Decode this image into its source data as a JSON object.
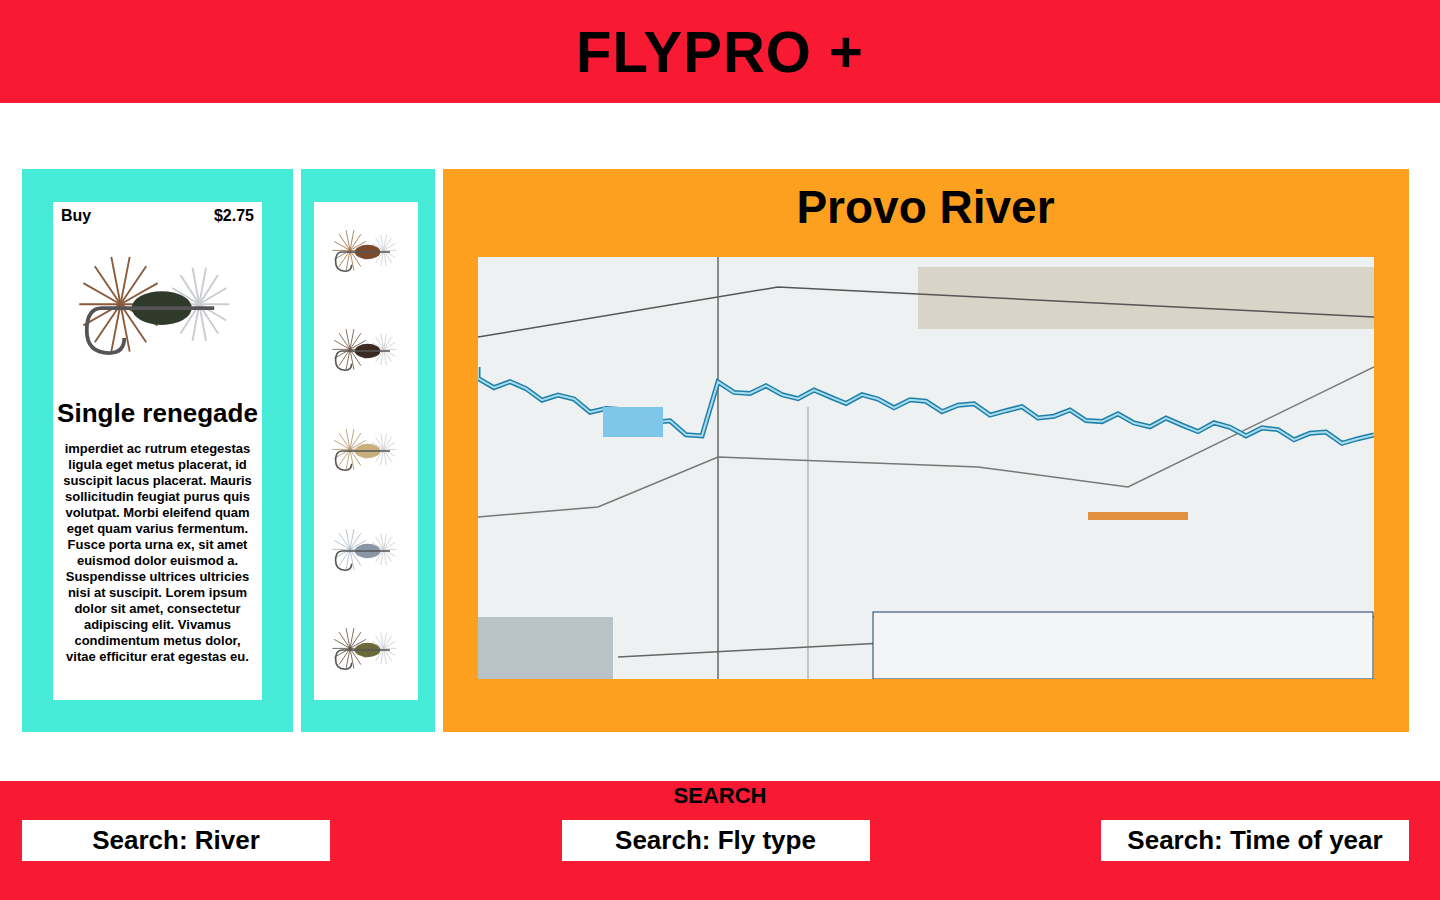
{
  "app": {
    "title": "FLYPRO +"
  },
  "product": {
    "action": "Buy",
    "price": "$2.75",
    "name": "Single renegade",
    "description": "imperdiet ac rutrum etegestas ligula eget metus placerat, id suscipit lacus placerat. Mauris sollicitudin feugiat purus quis volutpat. Morbi eleifend quam eget quam varius fermentum. Fusce porta urna ex, sit amet euismod dolor euismod a. Suspendisse ultrices ultricies nisi at suscipit. Lorem ipsum dolor sit amet, consectetur adipiscing elit. Vivamus condimentum metus dolor, vitae efficitur erat egestas eu."
  },
  "map": {
    "title": "Provo River"
  },
  "search": {
    "title": "SEARCH",
    "fields": [
      {
        "label": "Search: River"
      },
      {
        "label": "Search: Fly type"
      },
      {
        "label": "Search: Time of year"
      }
    ]
  }
}
